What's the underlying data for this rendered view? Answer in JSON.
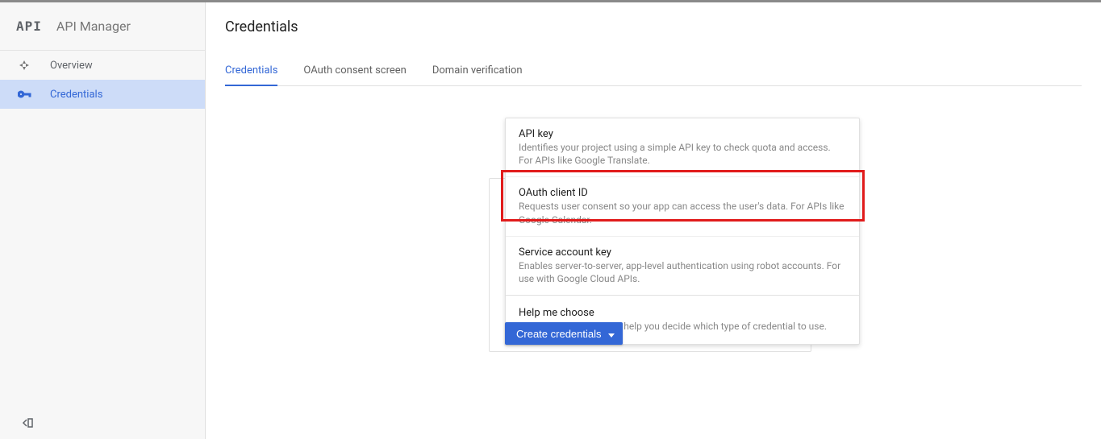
{
  "sidebar": {
    "logo_text": "API",
    "title": "API Manager",
    "items": [
      {
        "label": "Overview"
      },
      {
        "label": "Credentials"
      }
    ]
  },
  "page": {
    "title": "Credentials"
  },
  "tabs": [
    {
      "label": "Credentials"
    },
    {
      "label": "OAuth consent screen"
    },
    {
      "label": "Domain verification"
    }
  ],
  "menu": [
    {
      "title": "API key",
      "desc": "Identifies your project using a simple API key to check quota and access. For APIs like Google Translate."
    },
    {
      "title": "OAuth client ID",
      "desc": "Requests user consent so your app can access the user's data. For APIs like Google Calendar."
    },
    {
      "title": "Service account key",
      "desc": "Enables server-to-server, app-level authentication using robot accounts. For use with Google Cloud APIs."
    },
    {
      "title": "Help me choose",
      "desc": "Asks a few questions to help you decide which type of credential to use."
    }
  ],
  "button": {
    "create_label": "Create credentials"
  },
  "colors": {
    "accent": "#3367d6",
    "highlight": "#e11b1b"
  }
}
